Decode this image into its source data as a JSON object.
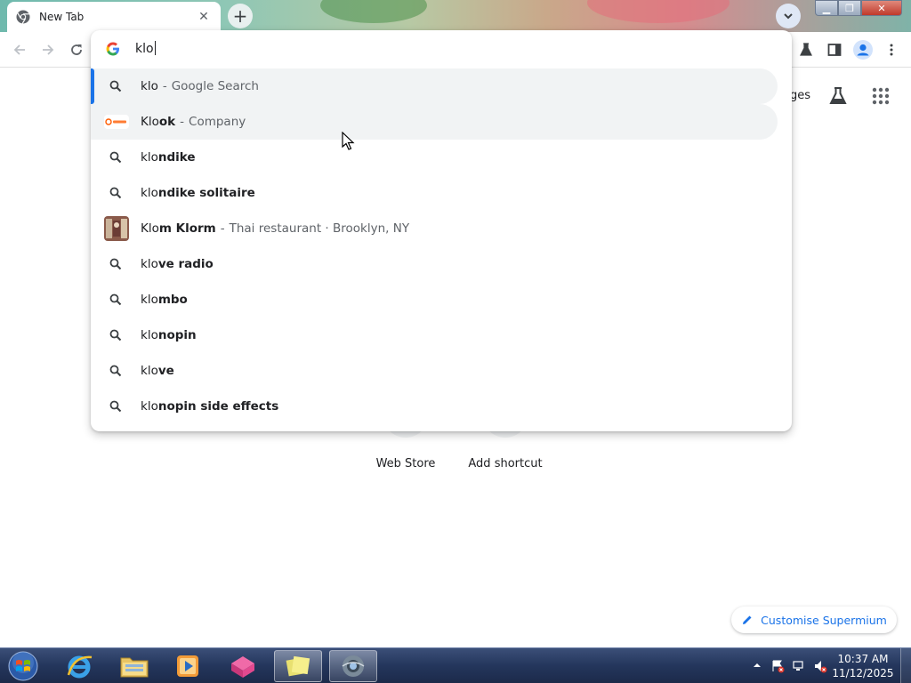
{
  "browser": {
    "tab_title": "New Tab",
    "omnibox_query": "klo"
  },
  "suggestions": [
    {
      "type": "search",
      "bold": "",
      "rest_plain": "klo",
      "detail": "Google Search",
      "selected": true
    },
    {
      "type": "entity",
      "typed": "Klo",
      "completion": "ok",
      "detail": "Company"
    },
    {
      "type": "search",
      "typed": "klo",
      "completion": "ndike"
    },
    {
      "type": "search",
      "typed": "klo",
      "completion": "ndike solitaire"
    },
    {
      "type": "entity",
      "typed": "Klo",
      "completion": "m Klorm",
      "detail": "Thai restaurant · Brooklyn, NY"
    },
    {
      "type": "search",
      "typed": "klo",
      "completion": "ve radio"
    },
    {
      "type": "search",
      "typed": "klo",
      "completion": "mbo"
    },
    {
      "type": "search",
      "typed": "klo",
      "completion": "nopin"
    },
    {
      "type": "search",
      "typed": "klo",
      "completion": "ve"
    },
    {
      "type": "search",
      "typed": "klo",
      "completion": "nopin side effects"
    }
  ],
  "ntp": {
    "images_link_partial": "ges",
    "shortcuts": [
      {
        "label": "Web Store"
      },
      {
        "label": "Add shortcut"
      }
    ],
    "customise_label": "Customise Supermium"
  },
  "taskbar": {
    "time": "10:37 AM",
    "date": "11/12/2025"
  },
  "colors": {
    "accent": "#1a73e8",
    "selected_row_bg": "#f1f3f4"
  },
  "icons": {
    "tab_favicon": "chrome-icon",
    "search_row": "search-icon",
    "omnibox_left": "google-g-icon"
  }
}
